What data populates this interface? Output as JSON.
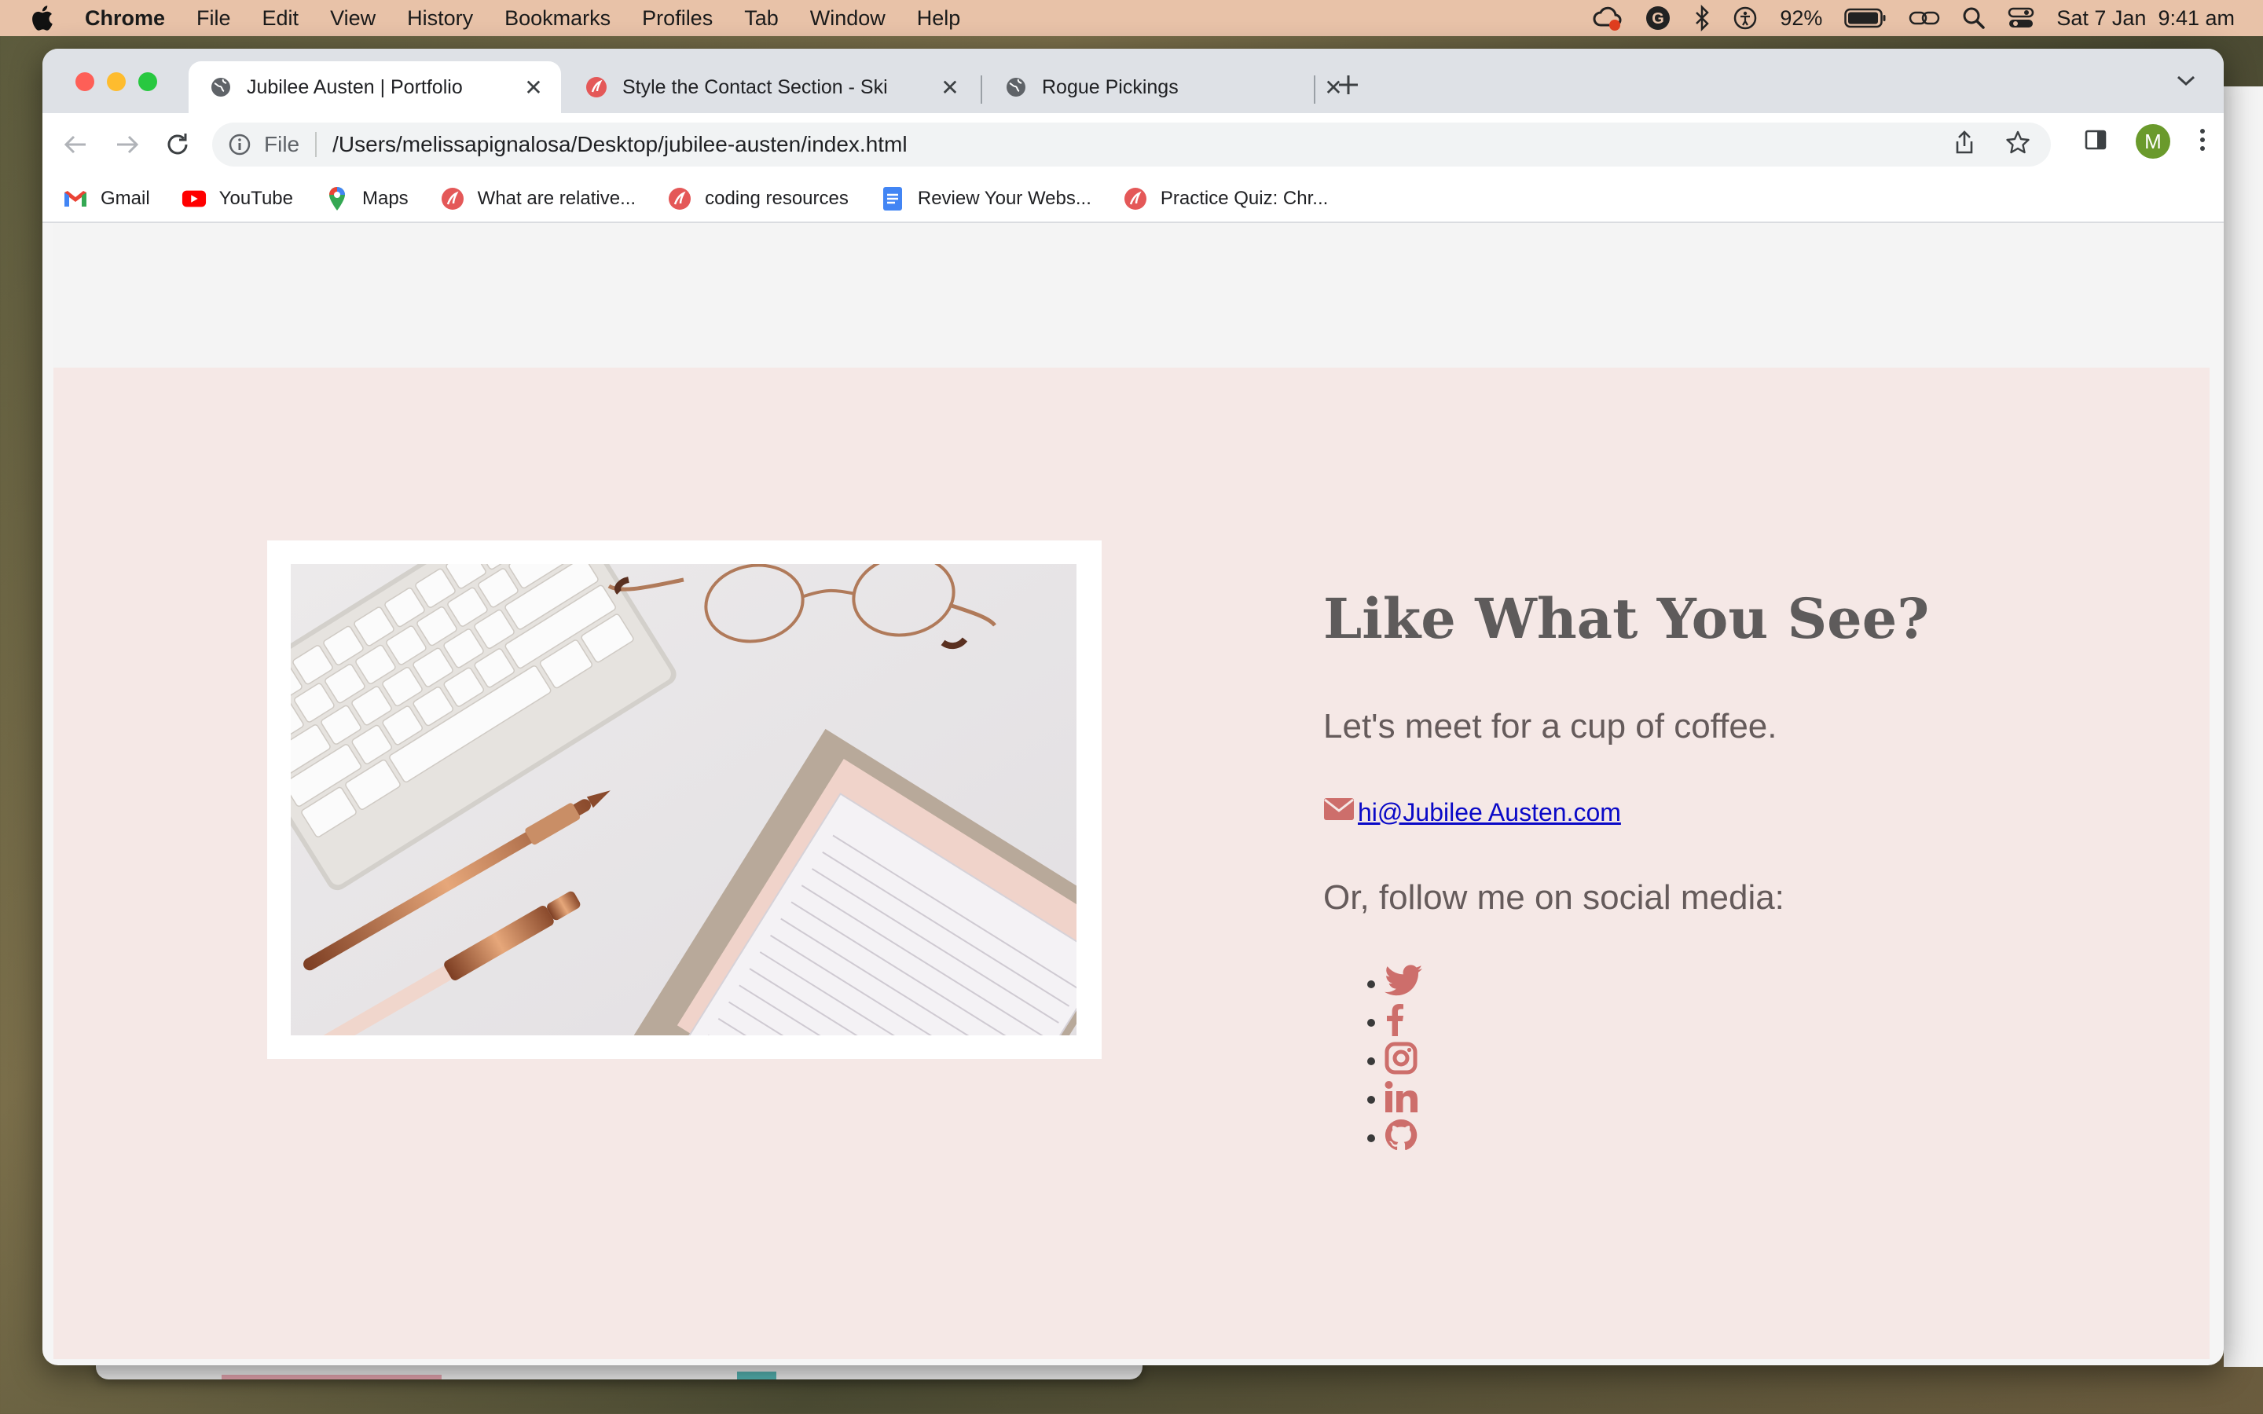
{
  "menubar": {
    "app": "Chrome",
    "items": [
      "File",
      "Edit",
      "View",
      "History",
      "Bookmarks",
      "Profiles",
      "Tab",
      "Window",
      "Help"
    ],
    "battery": "92%",
    "datetime": "Sat 7 Jan  9:41 am"
  },
  "tabs": [
    {
      "title": "Jubilee Austen | Portfolio",
      "icon": "globe-icon",
      "active": true
    },
    {
      "title": "Style the Contact Section - Ski",
      "icon": "skillcrush-icon",
      "active": false
    },
    {
      "title": "Rogue Pickings",
      "icon": "globe-icon",
      "active": false
    }
  ],
  "omnibox": {
    "scheme": "File",
    "url": "/Users/melissapignalosa/Desktop/jubilee-austen/index.html"
  },
  "profile": {
    "initial": "M"
  },
  "bookmarks": [
    {
      "label": "Gmail",
      "icon": "gmail-icon"
    },
    {
      "label": "YouTube",
      "icon": "youtube-icon"
    },
    {
      "label": "Maps",
      "icon": "maps-icon"
    },
    {
      "label": "What are relative...",
      "icon": "skillcrush-icon"
    },
    {
      "label": "coding resources",
      "icon": "skillcrush-icon"
    },
    {
      "label": "Review Your Webs...",
      "icon": "docs-icon"
    },
    {
      "label": "Practice Quiz: Chr...",
      "icon": "skillcrush-icon"
    }
  ],
  "contact": {
    "heading": "Like What You See?",
    "subheading": "Let's meet for a cup of coffee.",
    "email": "hi@Jubilee Austen.com",
    "follow": "Or, follow me on social media:",
    "social_icons": [
      "twitter-icon",
      "facebook-icon",
      "instagram-icon",
      "linkedin-icon",
      "github-icon"
    ],
    "accent_color": "#cd6e6b",
    "section_bg": "#f5e8e6"
  }
}
